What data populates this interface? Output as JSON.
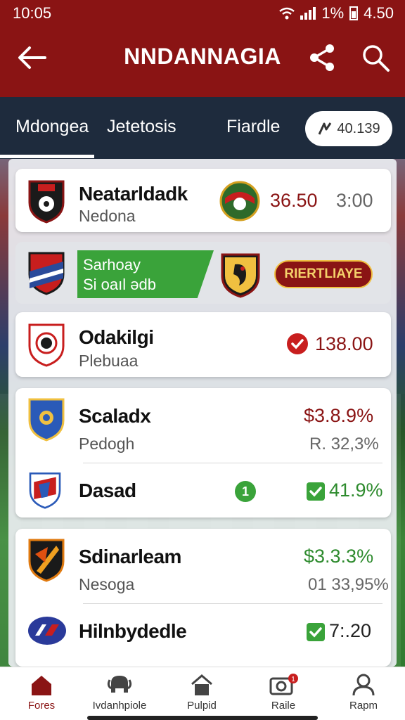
{
  "status_bar": {
    "time": "10:05",
    "battery": "1%",
    "clock_right": "4.50"
  },
  "app": {
    "title": "NNDANNAGIA"
  },
  "tabs": [
    {
      "label": "Mdongea",
      "active": true
    },
    {
      "label": "Jetetosis",
      "active": false
    },
    {
      "label": "Fiardle",
      "active": false
    }
  ],
  "filter_pill": {
    "label": "40.139"
  },
  "rows": [
    {
      "name": "Neatarldadk",
      "sub": "Nedona",
      "value1": "36.50",
      "value2": "3:00"
    },
    {
      "banner_line1": "Sarhoay",
      "banner_line2": "Si oaıl ədb",
      "badge": "RIERTLIAYE"
    },
    {
      "name": "Odakilgi",
      "sub": "Plebuaa",
      "value": "138.00"
    },
    {
      "name": "Scaladx",
      "sub": "Pedogh",
      "value": "$3.8.9%",
      "value2": "R. 32,3%"
    },
    {
      "name": "Dasad",
      "count": "1",
      "value": "41.9%"
    },
    {
      "name": "Sdinarleam",
      "sub": "Nesoga",
      "value": "$3.3.3%",
      "value2": "01 33,95%"
    },
    {
      "name": "Hilnbydedle",
      "value": "7:.20"
    }
  ],
  "bottom_nav": [
    {
      "label": "Fores",
      "icon": "home-icon",
      "active": true
    },
    {
      "label": "Ivdanhpiole",
      "icon": "elephant-icon",
      "active": false
    },
    {
      "label": "Pulpid",
      "icon": "house-icon",
      "active": false
    },
    {
      "label": "Raile",
      "icon": "camera-icon",
      "active": false
    },
    {
      "label": "Rapm",
      "icon": "user-icon",
      "active": false
    }
  ],
  "colors": {
    "brand": "#8a1414",
    "tab_bg": "#1e2b3d",
    "green": "#3aa33a"
  }
}
